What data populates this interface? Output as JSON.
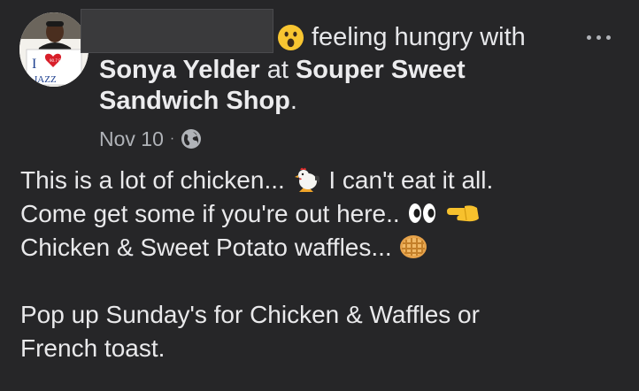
{
  "post": {
    "status_text": "feeling hungry with",
    "tagged_person": "Sonya Yelder",
    "at_word": "at",
    "place_line1": "Souper Sweet",
    "place_line2": "Sandwich Shop",
    "place_period": ".",
    "date": "Nov 10",
    "date_separator": "·",
    "privacy_icon": "globe-icon",
    "status_emoji": "astonished-face-emoji",
    "avatar_text": "JAZZ",
    "avatar_heart_text": "90.7 FM",
    "avatar_letter": "I",
    "body": {
      "line1_a": "This is a lot of chicken...",
      "line1_b": "I can't eat  it all.",
      "line2": "Come get some if you're out here..",
      "line3": "Chicken & Sweet Potato waffles...",
      "line4": "Pop up Sunday's for Chicken & Waffles or",
      "line5": "French toast."
    },
    "emojis": [
      "rooster-emoji",
      "eyes-emoji",
      "pointing-left-emoji",
      "waffle-emoji"
    ]
  },
  "colors": {
    "background": "#262628",
    "text": "#e6e7ea",
    "secondary_text": "#b0b3b8"
  }
}
